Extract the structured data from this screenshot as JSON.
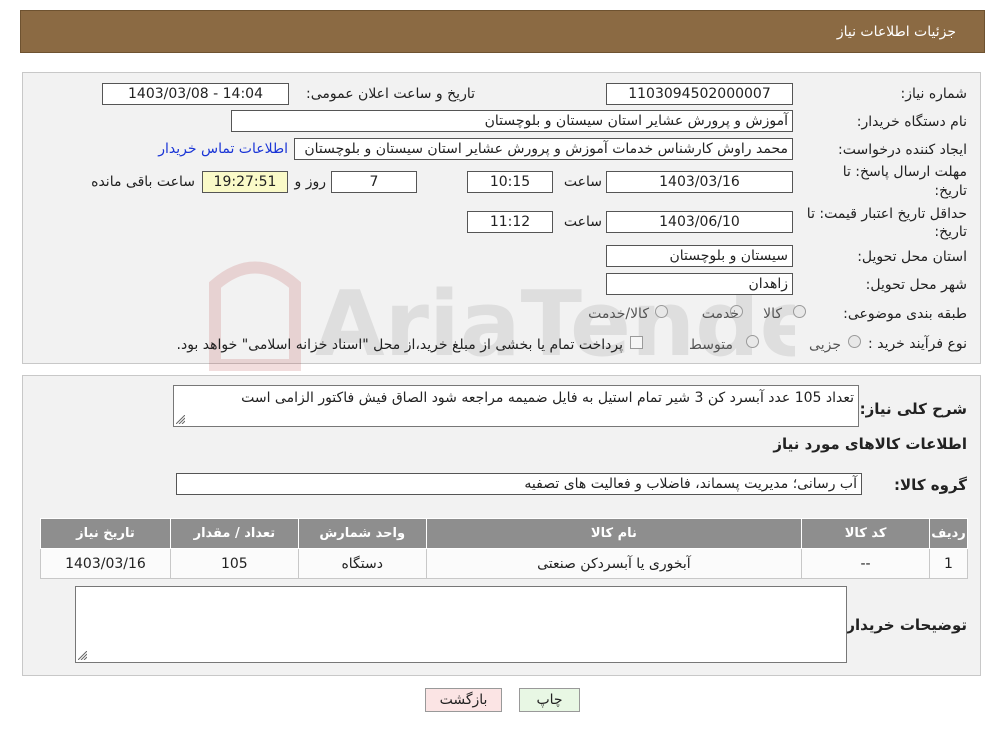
{
  "header": {
    "title": "جزئیات اطلاعات نیاز"
  },
  "form": {
    "need_number_label": "شماره نیاز:",
    "need_number": "1103094502000007",
    "announce_label": "تاریخ و ساعت اعلان عمومی:",
    "announce_value": "1403/03/08 - 14:04",
    "buyer_org_label": "نام دستگاه خریدار:",
    "buyer_org": "آموزش و پرورش عشایر استان سیستان و بلوچستان",
    "creator_label": "ایجاد کننده درخواست:",
    "creator": "محمد راوش کارشناس خدمات آموزش و پرورش عشایر استان سیستان و بلوچستان",
    "contact_link": "اطلاعات تماس خریدار",
    "deadline_label_1": "مهلت ارسال پاسخ: تا",
    "deadline_label_2": "تاریخ:",
    "deadline_date": "1403/03/16",
    "time_label": "ساعت",
    "deadline_time": "10:15",
    "days_value": "7",
    "days_label": "روز و",
    "remaining_time": "19:27:51",
    "remaining_label": "ساعت باقی مانده",
    "validity_label_1": "حداقل تاریخ اعتبار قیمت: تا",
    "validity_label_2": "تاریخ:",
    "validity_date": "1403/06/10",
    "validity_time_label": "ساعت",
    "validity_time": "11:12",
    "province_label": "استان محل تحویل:",
    "province": "سیستان و بلوچستان",
    "city_label": "شهر محل تحویل:",
    "city": "زاهدان",
    "category_label": "طبقه بندی موضوعی:",
    "category_options": [
      "کالا",
      "خدمت",
      "کالا/خدمت"
    ],
    "process_label": "نوع فرآیند خرید :",
    "process_options": [
      "جزیی",
      "متوسط"
    ],
    "process_note": "پرداخت تمام یا بخشی از مبلغ خرید،از محل \"اسناد خزانه اسلامی\" خواهد بود."
  },
  "description": {
    "label": "شرح کلی نیاز:",
    "text": "تعداد 105 عدد آبسرد کن 3 شیر تمام استیل به فایل ضمیمه مراجعه شود الصاق فیش فاکتور الزامی است"
  },
  "goods": {
    "section_title": "اطلاعات کالاهای مورد نیاز",
    "group_label": "گروه کالا:",
    "group_value": "آب رسانی؛ مدیریت پسماند، فاضلاب و فعالیت های تصفیه",
    "columns": [
      "ردیف",
      "کد کالا",
      "نام کالا",
      "واحد شمارش",
      "تعداد / مقدار",
      "تاریخ نیاز"
    ],
    "rows": [
      [
        "1",
        "--",
        "آبخوری یا آبسردکن صنعتی",
        "دستگاه",
        "105",
        "1403/03/16"
      ]
    ]
  },
  "buyer_notes": {
    "label": "توضیحات خریدار:"
  },
  "buttons": {
    "print": "چاپ",
    "back": "بازگشت"
  },
  "watermark": {
    "text": "AriaTender.neT"
  },
  "colors": {
    "header_bg": "#8b6a43",
    "link": "#1a35d6",
    "table_header": "#8e8e8e"
  }
}
